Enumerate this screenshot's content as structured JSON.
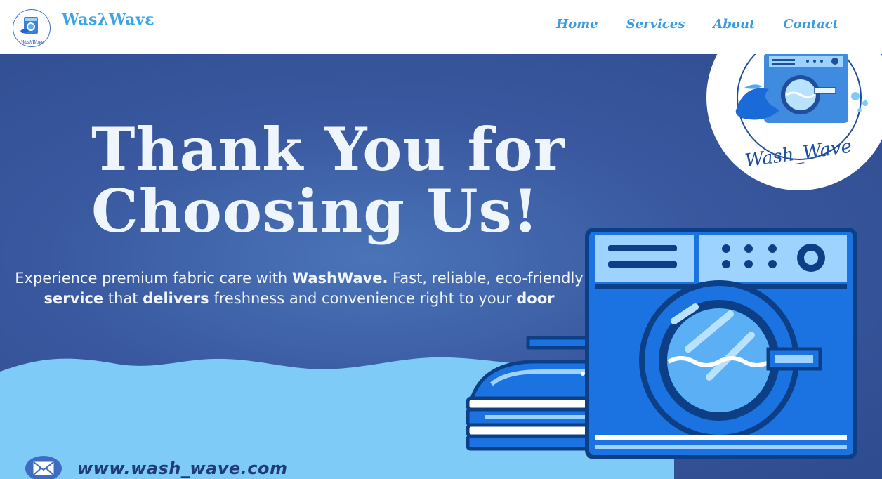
{
  "header": {
    "brand": "WasλWavε",
    "logo_caption": "WashWave",
    "nav": [
      {
        "label": "Home"
      },
      {
        "label": "Services"
      },
      {
        "label": "About"
      },
      {
        "label": "Contact"
      }
    ]
  },
  "hero": {
    "title_line1": "Thank You for",
    "title_line2": "Choosing Us!",
    "desc": {
      "p1": "Experience premium fabric care with ",
      "b1": "WashWave.",
      "p2": " Fast, reliable, eco-friendly ",
      "b2": "service",
      "p3": " that ",
      "b3": "delivers",
      "p4": " freshness and convenience right to your ",
      "b4": "door"
    },
    "badge_text": "Wash_Wave",
    "website": "www.wash_wave.com"
  },
  "icons": [
    "washing-machine-icon",
    "iron-icon",
    "envelope-icon",
    "logo-icon"
  ],
  "colors": {
    "brand": "#3aa5e6",
    "hero_dark": "#2f4b8f",
    "wave_light": "#7ecbf8",
    "machine_blue": "#1a73e0",
    "machine_dark": "#1558b0"
  }
}
